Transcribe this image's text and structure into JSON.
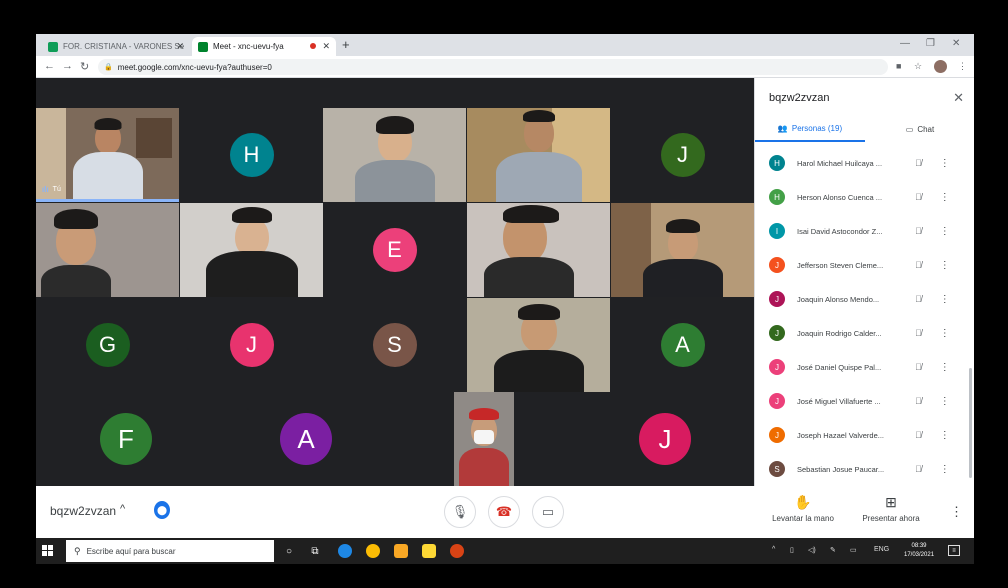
{
  "browser": {
    "tabs": [
      {
        "title": "FOR. CRISTIANA - VARONES Sec",
        "favicon_color": "#0f9d58"
      },
      {
        "title": "Meet - xnc-uevu-fya",
        "favicon_color": "#00832d"
      }
    ],
    "url": "meet.google.com/xnc-uevu-fya?authuser=0"
  },
  "meeting": {
    "code": "bqzw2zvzan",
    "self_label": "Tú"
  },
  "tiles": [
    {
      "kind": "video",
      "self": true
    },
    {
      "kind": "avatar",
      "initial": "H",
      "color": "#00838f"
    },
    {
      "kind": "video"
    },
    {
      "kind": "video"
    },
    {
      "kind": "avatar",
      "initial": "J",
      "color": "#33691e"
    },
    {
      "kind": "video"
    },
    {
      "kind": "video"
    },
    {
      "kind": "avatar",
      "initial": "E",
      "color": "#ec407a"
    },
    {
      "kind": "video"
    },
    {
      "kind": "video"
    },
    {
      "kind": "avatar",
      "initial": "G",
      "color": "#1b5e20"
    },
    {
      "kind": "avatar",
      "initial": "J",
      "color": "#e8336e"
    },
    {
      "kind": "avatar",
      "initial": "S",
      "color": "#795548"
    },
    {
      "kind": "video"
    },
    {
      "kind": "avatar",
      "initial": "A",
      "color": "#2e7d32"
    },
    {
      "kind": "avatar",
      "initial": "F",
      "color": "#2e7d32"
    },
    {
      "kind": "avatar",
      "initial": "A",
      "color": "#7b1fa2"
    },
    {
      "kind": "video",
      "small": true
    },
    {
      "kind": "avatar",
      "initial": "J",
      "color": "#d81b60"
    }
  ],
  "panel": {
    "title": "bqzw2zvzan",
    "people_tab": "Personas (19)",
    "chat_tab": "Chat",
    "people": [
      {
        "name": "Harol Michael Huilcaya ...",
        "initial": "H",
        "color": "#00838f"
      },
      {
        "name": "Herson Alonso Cuenca ...",
        "initial": "H",
        "color": "#43a047"
      },
      {
        "name": "Isai David Astocondor Z...",
        "initial": "I",
        "color": "#0097a7"
      },
      {
        "name": "Jefferson Steven Cleme...",
        "initial": "J",
        "color": "#f4511e"
      },
      {
        "name": "Joaquin Alonso Mendo...",
        "initial": "J",
        "color": "#ad1457"
      },
      {
        "name": "Joaquin Rodrigo Calder...",
        "initial": "J",
        "color": "#33691e"
      },
      {
        "name": "José Daniel Quispe Pal...",
        "initial": "J",
        "color": "#ec407a"
      },
      {
        "name": "José Miguel Villafuerte ...",
        "initial": "J",
        "color": "#ec407a"
      },
      {
        "name": "Joseph Hazael Valverde...",
        "initial": "J",
        "color": "#ef6c00"
      },
      {
        "name": "Sebastian Josue Paucar...",
        "initial": "S",
        "color": "#6d4c41"
      }
    ]
  },
  "controls": {
    "raise_hand": "Levantar la mano",
    "present_now": "Presentar ahora"
  },
  "taskbar": {
    "search_placeholder": "Escribe aquí para buscar",
    "lang": "ENG",
    "time": "08:39",
    "date": "17/03/2021"
  }
}
